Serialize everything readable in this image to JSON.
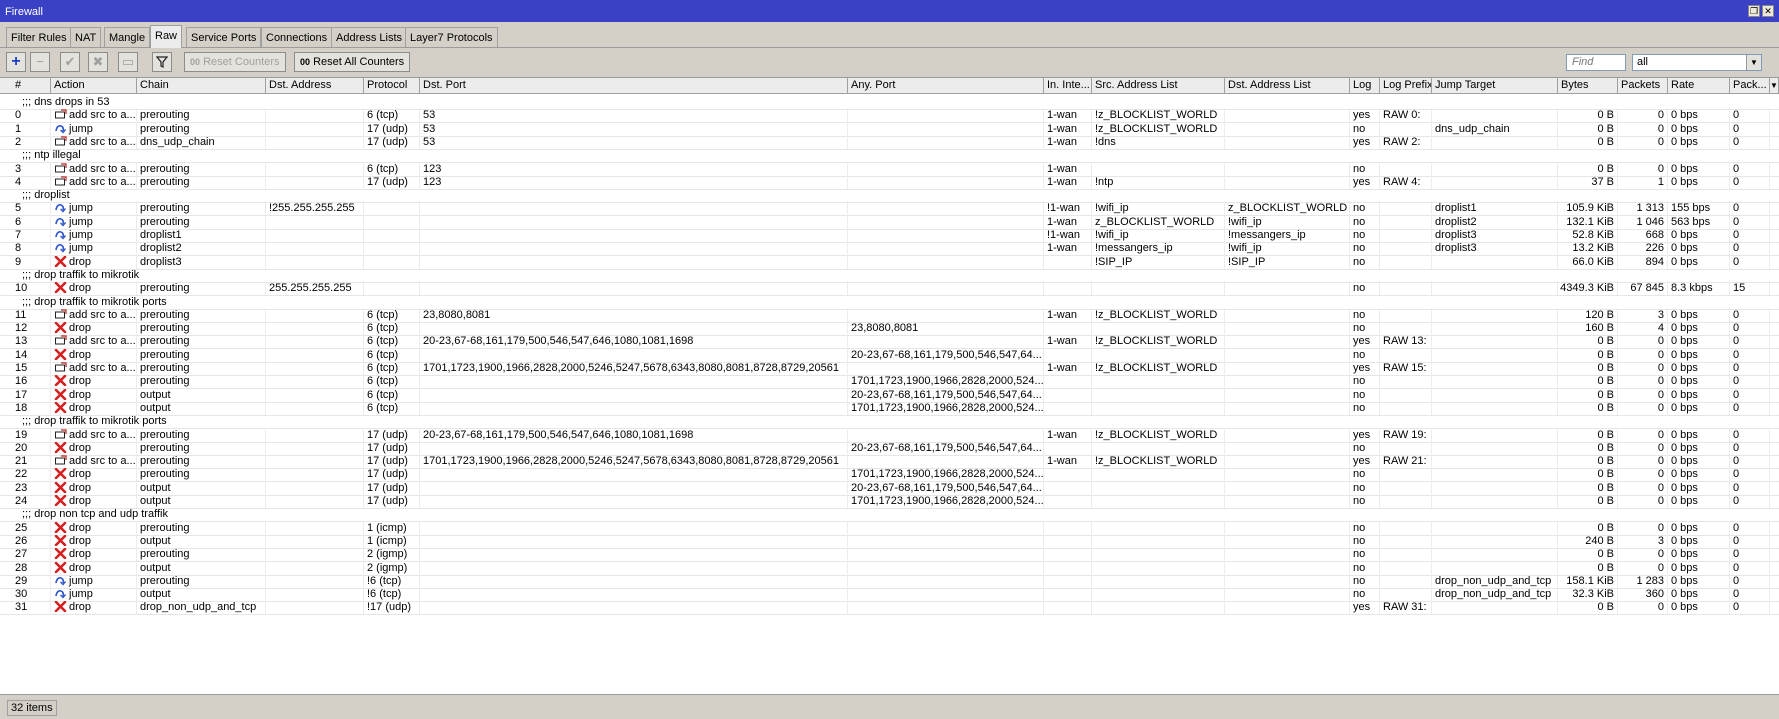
{
  "window": {
    "title": "Firewall"
  },
  "tabs": [
    "Filter Rules",
    "NAT",
    "Mangle",
    "Raw",
    "Service Ports",
    "Connections",
    "Address Lists",
    "Layer7 Protocols"
  ],
  "active_tab": "Raw",
  "toolbar": {
    "reset_counters": "Reset Counters",
    "reset_all_counters": "Reset All Counters",
    "find_placeholder": "Find",
    "filter_value": "all"
  },
  "columns": [
    "#",
    "Action",
    "Chain",
    "Dst. Address",
    "Protocol",
    "Dst. Port",
    "Any. Port",
    "In. Inte...",
    "Src. Address List",
    "Dst. Address List",
    "Log",
    "Log Prefix",
    "Jump Target",
    "Bytes",
    "Packets",
    "Rate",
    "Pack..."
  ],
  "rows": [
    {
      "comment": ";;; dns drops in 53"
    },
    {
      "num": "0",
      "action": "add src to a...",
      "icon": "add",
      "chain": "prerouting",
      "dst": "",
      "proto": "6 (tcp)",
      "dport": "53",
      "anyport": "",
      "inif": "1-wan",
      "src_list": "!z_BLOCKLIST_WORLD",
      "dst_list": "",
      "log": "yes",
      "log_prefix": "RAW 0:",
      "jump": "",
      "bytes": "0 B",
      "packets": "0",
      "rate": "0 bps",
      "pack": "0"
    },
    {
      "num": "1",
      "action": "jump",
      "icon": "jump",
      "chain": "prerouting",
      "dst": "",
      "proto": "17 (udp)",
      "dport": "53",
      "anyport": "",
      "inif": "1-wan",
      "src_list": "!z_BLOCKLIST_WORLD",
      "dst_list": "",
      "log": "no",
      "log_prefix": "",
      "jump": "dns_udp_chain",
      "bytes": "0 B",
      "packets": "0",
      "rate": "0 bps",
      "pack": "0"
    },
    {
      "num": "2",
      "action": "add src to a...",
      "icon": "add",
      "chain": "dns_udp_chain",
      "dst": "",
      "proto": "17 (udp)",
      "dport": "53",
      "anyport": "",
      "inif": "1-wan",
      "src_list": "!dns",
      "dst_list": "",
      "log": "yes",
      "log_prefix": "RAW 2:",
      "jump": "",
      "bytes": "0 B",
      "packets": "0",
      "rate": "0 bps",
      "pack": "0"
    },
    {
      "comment": ";;; ntp illegal"
    },
    {
      "num": "3",
      "action": "add src to a...",
      "icon": "add",
      "chain": "prerouting",
      "dst": "",
      "proto": "6 (tcp)",
      "dport": "123",
      "anyport": "",
      "inif": "1-wan",
      "src_list": "",
      "dst_list": "",
      "log": "no",
      "log_prefix": "",
      "jump": "",
      "bytes": "0 B",
      "packets": "0",
      "rate": "0 bps",
      "pack": "0"
    },
    {
      "num": "4",
      "action": "add src to a...",
      "icon": "add",
      "chain": "prerouting",
      "dst": "",
      "proto": "17 (udp)",
      "dport": "123",
      "anyport": "",
      "inif": "1-wan",
      "src_list": "!ntp",
      "dst_list": "",
      "log": "yes",
      "log_prefix": "RAW 4:",
      "jump": "",
      "bytes": "37 B",
      "packets": "1",
      "rate": "0 bps",
      "pack": "0"
    },
    {
      "comment": ";;; droplist"
    },
    {
      "num": "5",
      "action": "jump",
      "icon": "jump",
      "chain": "prerouting",
      "dst": "!255.255.255.255",
      "proto": "",
      "dport": "",
      "anyport": "",
      "inif": "!1-wan",
      "src_list": "!wifi_ip",
      "dst_list": "z_BLOCKLIST_WORLD",
      "log": "no",
      "log_prefix": "",
      "jump": "droplist1",
      "bytes": "105.9 KiB",
      "packets": "1 313",
      "rate": "155 bps",
      "pack": "0"
    },
    {
      "num": "6",
      "action": "jump",
      "icon": "jump",
      "chain": "prerouting",
      "dst": "",
      "proto": "",
      "dport": "",
      "anyport": "",
      "inif": "1-wan",
      "src_list": "z_BLOCKLIST_WORLD",
      "dst_list": "!wifi_ip",
      "log": "no",
      "log_prefix": "",
      "jump": "droplist2",
      "bytes": "132.1 KiB",
      "packets": "1 046",
      "rate": "563 bps",
      "pack": "0"
    },
    {
      "num": "7",
      "action": "jump",
      "icon": "jump",
      "chain": "droplist1",
      "dst": "",
      "proto": "",
      "dport": "",
      "anyport": "",
      "inif": "!1-wan",
      "src_list": "!wifi_ip",
      "dst_list": "!messangers_ip",
      "log": "no",
      "log_prefix": "",
      "jump": "droplist3",
      "bytes": "52.8 KiB",
      "packets": "668",
      "rate": "0 bps",
      "pack": "0"
    },
    {
      "num": "8",
      "action": "jump",
      "icon": "jump",
      "chain": "droplist2",
      "dst": "",
      "proto": "",
      "dport": "",
      "anyport": "",
      "inif": "1-wan",
      "src_list": "!messangers_ip",
      "dst_list": "!wifi_ip",
      "log": "no",
      "log_prefix": "",
      "jump": "droplist3",
      "bytes": "13.2 KiB",
      "packets": "226",
      "rate": "0 bps",
      "pack": "0"
    },
    {
      "num": "9",
      "action": "drop",
      "icon": "drop",
      "chain": "droplist3",
      "dst": "",
      "proto": "",
      "dport": "",
      "anyport": "",
      "inif": "",
      "src_list": "!SIP_IP",
      "dst_list": "!SIP_IP",
      "log": "no",
      "log_prefix": "",
      "jump": "",
      "bytes": "66.0 KiB",
      "packets": "894",
      "rate": "0 bps",
      "pack": "0"
    },
    {
      "comment": ";;; drop traffik to mikrotik"
    },
    {
      "num": "10",
      "action": "drop",
      "icon": "drop",
      "chain": "prerouting",
      "dst": "255.255.255.255",
      "proto": "",
      "dport": "",
      "anyport": "",
      "inif": "",
      "src_list": "",
      "dst_list": "",
      "log": "no",
      "log_prefix": "",
      "jump": "",
      "bytes": "4349.3 KiB",
      "packets": "67 845",
      "rate": "8.3 kbps",
      "pack": "15"
    },
    {
      "comment": ";;; drop traffik to mikrotik ports"
    },
    {
      "num": "11",
      "action": "add src to a...",
      "icon": "add",
      "chain": "prerouting",
      "dst": "",
      "proto": "6 (tcp)",
      "dport": "23,8080,8081",
      "anyport": "",
      "inif": "1-wan",
      "src_list": "!z_BLOCKLIST_WORLD",
      "dst_list": "",
      "log": "no",
      "log_prefix": "",
      "jump": "",
      "bytes": "120 B",
      "packets": "3",
      "rate": "0 bps",
      "pack": "0"
    },
    {
      "num": "12",
      "action": "drop",
      "icon": "drop",
      "chain": "prerouting",
      "dst": "",
      "proto": "6 (tcp)",
      "dport": "",
      "anyport": "23,8080,8081",
      "inif": "",
      "src_list": "",
      "dst_list": "",
      "log": "no",
      "log_prefix": "",
      "jump": "",
      "bytes": "160 B",
      "packets": "4",
      "rate": "0 bps",
      "pack": "0"
    },
    {
      "num": "13",
      "action": "add src to a...",
      "icon": "add",
      "chain": "prerouting",
      "dst": "",
      "proto": "6 (tcp)",
      "dport": "20-23,67-68,161,179,500,546,547,646,1080,1081,1698",
      "anyport": "",
      "inif": "1-wan",
      "src_list": "!z_BLOCKLIST_WORLD",
      "dst_list": "",
      "log": "yes",
      "log_prefix": "RAW 13:",
      "jump": "",
      "bytes": "0 B",
      "packets": "0",
      "rate": "0 bps",
      "pack": "0"
    },
    {
      "num": "14",
      "action": "drop",
      "icon": "drop",
      "chain": "prerouting",
      "dst": "",
      "proto": "6 (tcp)",
      "dport": "",
      "anyport": "20-23,67-68,161,179,500,546,547,64...",
      "inif": "",
      "src_list": "",
      "dst_list": "",
      "log": "no",
      "log_prefix": "",
      "jump": "",
      "bytes": "0 B",
      "packets": "0",
      "rate": "0 bps",
      "pack": "0"
    },
    {
      "num": "15",
      "action": "add src to a...",
      "icon": "add",
      "chain": "prerouting",
      "dst": "",
      "proto": "6 (tcp)",
      "dport": "1701,1723,1900,1966,2828,2000,5246,5247,5678,6343,8080,8081,8728,8729,20561",
      "anyport": "",
      "inif": "1-wan",
      "src_list": "!z_BLOCKLIST_WORLD",
      "dst_list": "",
      "log": "yes",
      "log_prefix": "RAW 15:",
      "jump": "",
      "bytes": "0 B",
      "packets": "0",
      "rate": "0 bps",
      "pack": "0"
    },
    {
      "num": "16",
      "action": "drop",
      "icon": "drop",
      "chain": "prerouting",
      "dst": "",
      "proto": "6 (tcp)",
      "dport": "",
      "anyport": "1701,1723,1900,1966,2828,2000,524...",
      "inif": "",
      "src_list": "",
      "dst_list": "",
      "log": "no",
      "log_prefix": "",
      "jump": "",
      "bytes": "0 B",
      "packets": "0",
      "rate": "0 bps",
      "pack": "0"
    },
    {
      "num": "17",
      "action": "drop",
      "icon": "drop",
      "chain": "output",
      "dst": "",
      "proto": "6 (tcp)",
      "dport": "",
      "anyport": "20-23,67-68,161,179,500,546,547,64...",
      "inif": "",
      "src_list": "",
      "dst_list": "",
      "log": "no",
      "log_prefix": "",
      "jump": "",
      "bytes": "0 B",
      "packets": "0",
      "rate": "0 bps",
      "pack": "0"
    },
    {
      "num": "18",
      "action": "drop",
      "icon": "drop",
      "chain": "output",
      "dst": "",
      "proto": "6 (tcp)",
      "dport": "",
      "anyport": "1701,1723,1900,1966,2828,2000,524...",
      "inif": "",
      "src_list": "",
      "dst_list": "",
      "log": "no",
      "log_prefix": "",
      "jump": "",
      "bytes": "0 B",
      "packets": "0",
      "rate": "0 bps",
      "pack": "0"
    },
    {
      "comment": ";;; drop traffik to mikrotik ports"
    },
    {
      "num": "19",
      "action": "add src to a...",
      "icon": "add",
      "chain": "prerouting",
      "dst": "",
      "proto": "17 (udp)",
      "dport": "20-23,67-68,161,179,500,546,547,646,1080,1081,1698",
      "anyport": "",
      "inif": "1-wan",
      "src_list": "!z_BLOCKLIST_WORLD",
      "dst_list": "",
      "log": "yes",
      "log_prefix": "RAW 19:",
      "jump": "",
      "bytes": "0 B",
      "packets": "0",
      "rate": "0 bps",
      "pack": "0"
    },
    {
      "num": "20",
      "action": "drop",
      "icon": "drop",
      "chain": "prerouting",
      "dst": "",
      "proto": "17 (udp)",
      "dport": "",
      "anyport": "20-23,67-68,161,179,500,546,547,64...",
      "inif": "",
      "src_list": "",
      "dst_list": "",
      "log": "no",
      "log_prefix": "",
      "jump": "",
      "bytes": "0 B",
      "packets": "0",
      "rate": "0 bps",
      "pack": "0"
    },
    {
      "num": "21",
      "action": "add src to a...",
      "icon": "add",
      "chain": "prerouting",
      "dst": "",
      "proto": "17 (udp)",
      "dport": "1701,1723,1900,1966,2828,2000,5246,5247,5678,6343,8080,8081,8728,8729,20561",
      "anyport": "",
      "inif": "1-wan",
      "src_list": "!z_BLOCKLIST_WORLD",
      "dst_list": "",
      "log": "yes",
      "log_prefix": "RAW 21:",
      "jump": "",
      "bytes": "0 B",
      "packets": "0",
      "rate": "0 bps",
      "pack": "0"
    },
    {
      "num": "22",
      "action": "drop",
      "icon": "drop",
      "chain": "prerouting",
      "dst": "",
      "proto": "17 (udp)",
      "dport": "",
      "anyport": "1701,1723,1900,1966,2828,2000,524...",
      "inif": "",
      "src_list": "",
      "dst_list": "",
      "log": "no",
      "log_prefix": "",
      "jump": "",
      "bytes": "0 B",
      "packets": "0",
      "rate": "0 bps",
      "pack": "0"
    },
    {
      "num": "23",
      "action": "drop",
      "icon": "drop",
      "chain": "output",
      "dst": "",
      "proto": "17 (udp)",
      "dport": "",
      "anyport": "20-23,67-68,161,179,500,546,547,64...",
      "inif": "",
      "src_list": "",
      "dst_list": "",
      "log": "no",
      "log_prefix": "",
      "jump": "",
      "bytes": "0 B",
      "packets": "0",
      "rate": "0 bps",
      "pack": "0"
    },
    {
      "num": "24",
      "action": "drop",
      "icon": "drop",
      "chain": "output",
      "dst": "",
      "proto": "17 (udp)",
      "dport": "",
      "anyport": "1701,1723,1900,1966,2828,2000,524...",
      "inif": "",
      "src_list": "",
      "dst_list": "",
      "log": "no",
      "log_prefix": "",
      "jump": "",
      "bytes": "0 B",
      "packets": "0",
      "rate": "0 bps",
      "pack": "0"
    },
    {
      "comment": ";;; drop non tcp and udp traffik"
    },
    {
      "num": "25",
      "action": "drop",
      "icon": "drop",
      "chain": "prerouting",
      "dst": "",
      "proto": "1 (icmp)",
      "dport": "",
      "anyport": "",
      "inif": "",
      "src_list": "",
      "dst_list": "",
      "log": "no",
      "log_prefix": "",
      "jump": "",
      "bytes": "0 B",
      "packets": "0",
      "rate": "0 bps",
      "pack": "0"
    },
    {
      "num": "26",
      "action": "drop",
      "icon": "drop",
      "chain": "output",
      "dst": "",
      "proto": "1 (icmp)",
      "dport": "",
      "anyport": "",
      "inif": "",
      "src_list": "",
      "dst_list": "",
      "log": "no",
      "log_prefix": "",
      "jump": "",
      "bytes": "240 B",
      "packets": "3",
      "rate": "0 bps",
      "pack": "0"
    },
    {
      "num": "27",
      "action": "drop",
      "icon": "drop",
      "chain": "prerouting",
      "dst": "",
      "proto": "2 (igmp)",
      "dport": "",
      "anyport": "",
      "inif": "",
      "src_list": "",
      "dst_list": "",
      "log": "no",
      "log_prefix": "",
      "jump": "",
      "bytes": "0 B",
      "packets": "0",
      "rate": "0 bps",
      "pack": "0"
    },
    {
      "num": "28",
      "action": "drop",
      "icon": "drop",
      "chain": "output",
      "dst": "",
      "proto": "2 (igmp)",
      "dport": "",
      "anyport": "",
      "inif": "",
      "src_list": "",
      "dst_list": "",
      "log": "no",
      "log_prefix": "",
      "jump": "",
      "bytes": "0 B",
      "packets": "0",
      "rate": "0 bps",
      "pack": "0"
    },
    {
      "num": "29",
      "action": "jump",
      "icon": "jump",
      "chain": "prerouting",
      "dst": "",
      "proto": "!6 (tcp)",
      "dport": "",
      "anyport": "",
      "inif": "",
      "src_list": "",
      "dst_list": "",
      "log": "no",
      "log_prefix": "",
      "jump": "drop_non_udp_and_tcp",
      "bytes": "158.1 KiB",
      "packets": "1 283",
      "rate": "0 bps",
      "pack": "0"
    },
    {
      "num": "30",
      "action": "jump",
      "icon": "jump",
      "chain": "output",
      "dst": "",
      "proto": "!6 (tcp)",
      "dport": "",
      "anyport": "",
      "inif": "",
      "src_list": "",
      "dst_list": "",
      "log": "no",
      "log_prefix": "",
      "jump": "drop_non_udp_and_tcp",
      "bytes": "32.3 KiB",
      "packets": "360",
      "rate": "0 bps",
      "pack": "0"
    },
    {
      "num": "31",
      "action": "drop",
      "icon": "drop",
      "chain": "drop_non_udp_and_tcp",
      "dst": "",
      "proto": "!17 (udp)",
      "dport": "",
      "anyport": "",
      "inif": "",
      "src_list": "",
      "dst_list": "",
      "log": "yes",
      "log_prefix": "RAW 31:",
      "jump": "",
      "bytes": "0 B",
      "packets": "0",
      "rate": "0 bps",
      "pack": "0"
    }
  ],
  "status": {
    "items_count": "32 items"
  },
  "colors": {
    "titlebar": "#3b41c4",
    "drop_icon": "#d42020",
    "jump_icon": "#2d56c8"
  }
}
